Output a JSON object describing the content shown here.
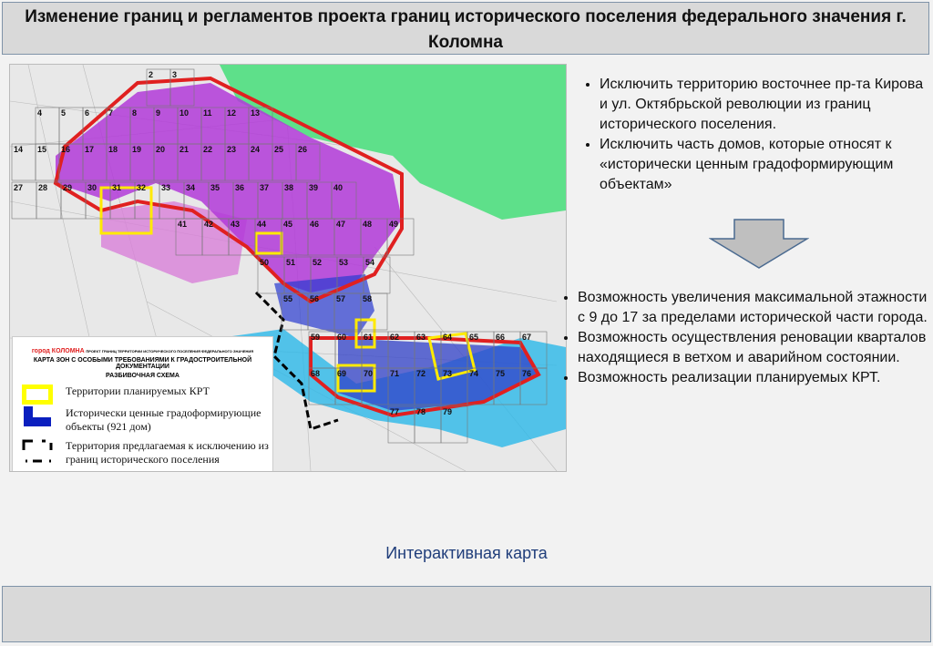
{
  "title": "Изменение границ и регламентов проекта границ исторического поселения федерального значения г. Коломна",
  "map": {
    "grid_rows": [
      [
        "2",
        "3"
      ],
      [
        "4",
        "5",
        "6",
        "7",
        "8",
        "9",
        "10",
        "11",
        "12",
        "13"
      ],
      [
        "14",
        "15",
        "16",
        "17",
        "18",
        "19",
        "20",
        "21",
        "22",
        "23",
        "24",
        "25",
        "26"
      ],
      [
        "27",
        "28",
        "29",
        "30",
        "31",
        "32",
        "33",
        "34",
        "35",
        "36",
        "37",
        "38",
        "39",
        "40"
      ],
      [
        "41",
        "42",
        "43",
        "44",
        "45",
        "46",
        "47",
        "48",
        "49"
      ],
      [
        "50",
        "51",
        "52",
        "53",
        "54"
      ],
      [
        "55",
        "56",
        "57",
        "58"
      ],
      [
        "59",
        "60",
        "61",
        "62",
        "63",
        "64",
        "65",
        "66",
        "67"
      ],
      [
        "68",
        "69",
        "70",
        "71",
        "72",
        "73",
        "74",
        "75",
        "76"
      ],
      [
        "77",
        "78",
        "79"
      ]
    ],
    "legend": {
      "city": "город КОЛОМНА",
      "project": "ПРОЕКТ ГРАНИЦ ТЕРРИТОРИИ ИСТОРИЧЕСКОГО ПОСЕЛЕНИЯ ФЕДЕРАЛЬНОГО ЗНАЧЕНИЯ",
      "heading": "КАРТА ЗОН С ОСОБЫМИ ТРЕБОВАНИЯМИ К ГРАДОСТРОИТЕЛЬНОЙ ДОКУМЕНТАЦИИ",
      "subheading": "РАЗБИВОЧНАЯ СХЕМА",
      "items": [
        {
          "label": "Территории планируемых КРТ",
          "color": "#ffff00"
        },
        {
          "label": "Исторически ценные градоформирующие объекты (921 дом)",
          "color": "#0a1fbf"
        },
        {
          "label": "Территория предлагаемая к исключению из границ исторического поселения",
          "color": "#000000"
        }
      ]
    }
  },
  "bullets_top": [
    "Исключить территорию восточнее пр-та Кирова и ул. Октябрьской революции из границ исторического поселения.",
    "Исключить часть домов, которые относят к «исторически ценным градоформирующим объектам»"
  ],
  "bullets_bottom": [
    "Возможность увеличения максимальной этажности с 9 до 17 за пределами исторической части города.",
    "Возможность осуществления реновации кварталов находящиеся в ветхом и аварийном состоянии.",
    "Возможность реализации планируемых КРТ."
  ],
  "link": "Интерактивная карта",
  "colors": {
    "green": "#5ee08a",
    "magenta": "#c04ad8",
    "red": "#e02020",
    "river": "#2ab8e8"
  }
}
